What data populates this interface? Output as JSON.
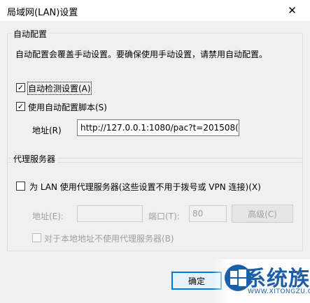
{
  "window": {
    "title": "局域网(LAN)设置",
    "close_glyph": "✕"
  },
  "auto_config": {
    "group_label": "自动配置",
    "description": "自动配置会覆盖手动设置。要确保使用手动设置，请禁用自动配置。",
    "auto_detect_label": "自动检测设置(A)",
    "auto_detect_checked": true,
    "use_script_label": "使用自动配置脚本(S)",
    "use_script_checked": true,
    "address_label": "地址(R)",
    "address_value": "http://127.0.0.1:1080/pac?t=201508("
  },
  "proxy": {
    "group_label": "代理服务器",
    "use_proxy_label": "为 LAN 使用代理服务器(这些设置不用于拨号或 VPN 连接)(X)",
    "use_proxy_checked": false,
    "address_label": "地址(E):",
    "address_value": "",
    "port_label": "端口(T):",
    "port_value": "80",
    "advanced_label": "高级(C)",
    "bypass_label": "对于本地地址不使用代理服务器(B)",
    "bypass_checked": false
  },
  "footer": {
    "ok_label": "确定"
  },
  "watermark": {
    "brand": "系统族",
    "url": "WWW.XITONGZU.COM"
  },
  "glyphs": {
    "check": "✓"
  }
}
